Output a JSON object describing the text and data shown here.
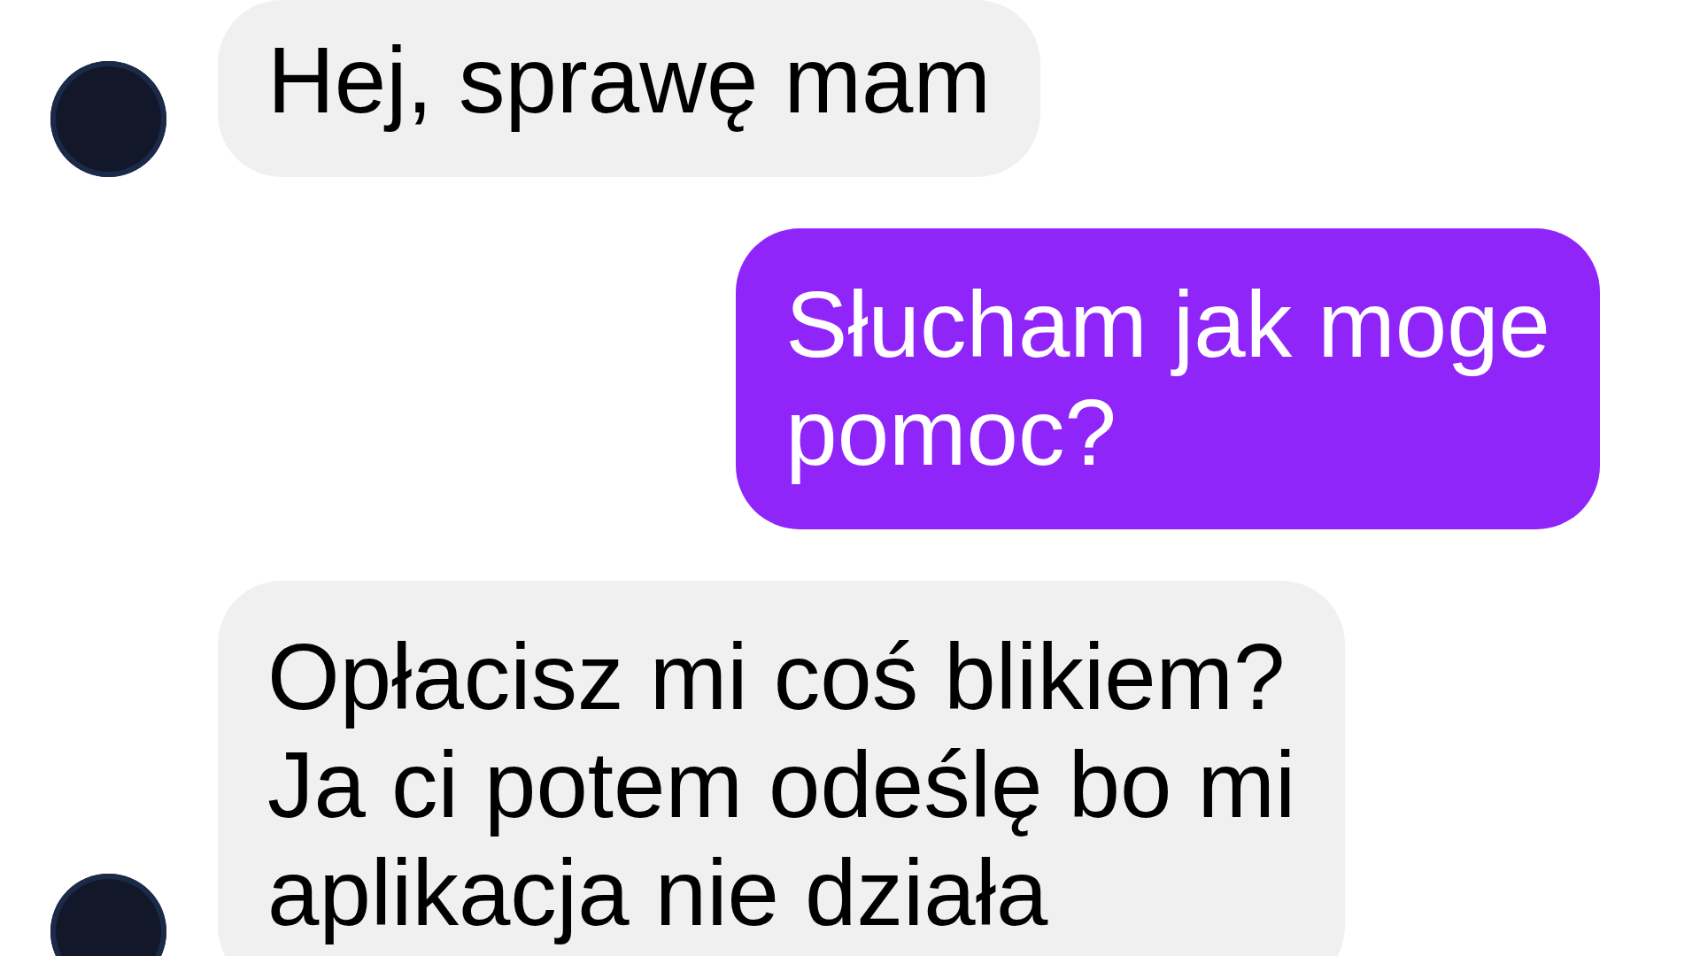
{
  "messages": [
    {
      "kind": "incoming",
      "lines": [
        "Hej, sprawę mam"
      ]
    },
    {
      "kind": "outgoing",
      "lines": [
        "Słucham jak moge",
        "pomoc?"
      ]
    },
    {
      "kind": "incoming",
      "lines": [
        "Opłacisz mi coś blikiem?",
        "Ja ci potem odeślę bo mi",
        "aplikacja nie działa"
      ]
    }
  ]
}
